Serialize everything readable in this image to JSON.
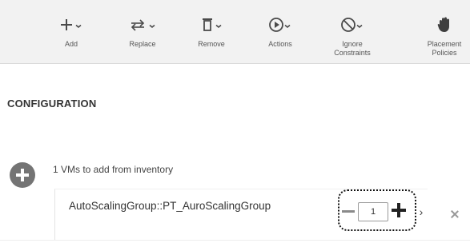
{
  "toolbar": {
    "add_label": "Add",
    "replace_label": "Replace",
    "remove_label": "Remove",
    "actions_label": "Actions",
    "ignore_label": "Ignore\nConstraints",
    "placement_label": "Placement\nPolicies",
    "icons": {
      "add": "plus-dropdown-icon",
      "replace": "swap-dropdown-icon",
      "remove": "trash-dropdown-icon",
      "actions": "play-circle-dropdown-icon",
      "ignore": "ban-dropdown-icon",
      "placement": "hand-icon"
    }
  },
  "main": {
    "section_title": "CONFIGURATION",
    "add_from_inventory_text": "1 VMs to add from inventory"
  },
  "group": {
    "name": "AutoScalingGroup::PT_AuroScalingGroup",
    "quantity": "1",
    "chevron": "›"
  },
  "colors": {
    "toolbar_bg": "#f2f2f2",
    "text": "#333333",
    "muted": "#555555",
    "add_circle": "#747474"
  }
}
